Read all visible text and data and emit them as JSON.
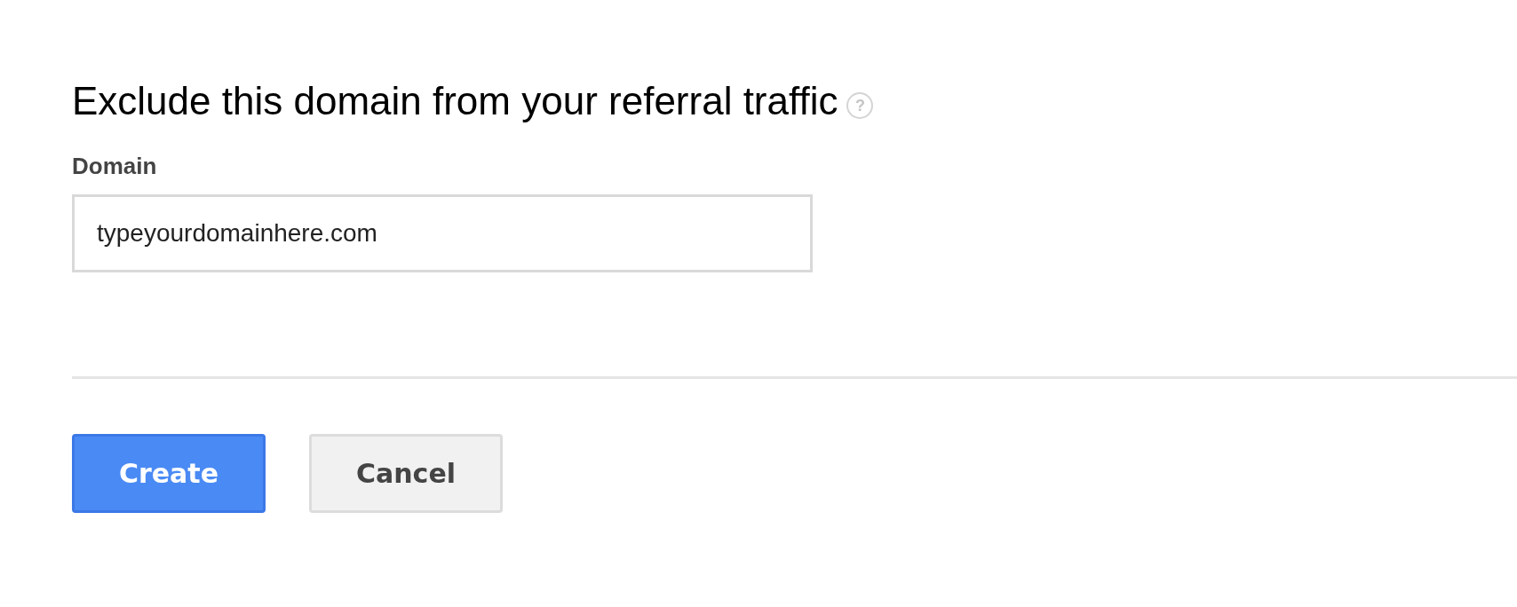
{
  "title": "Exclude this domain from your referral traffic",
  "help_icon": "?",
  "field": {
    "label": "Domain",
    "value": "typeyourdomainhere.com"
  },
  "buttons": [
    {
      "label": "Create",
      "kind": "primary"
    },
    {
      "label": "Cancel",
      "kind": "secondary"
    }
  ]
}
